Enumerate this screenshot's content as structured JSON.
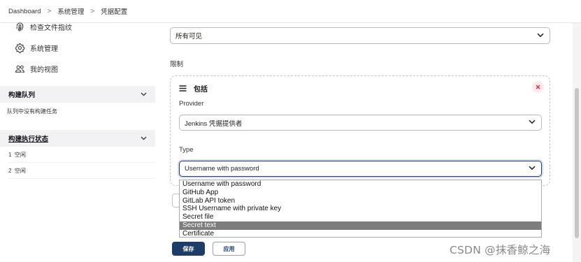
{
  "breadcrumb": {
    "items": [
      "Dashboard",
      "系统管理",
      "凭据配置"
    ],
    "separator": ">"
  },
  "sidebar": {
    "links": [
      {
        "label": "检查文件指纹",
        "icon": "fingerprint-icon"
      },
      {
        "label": "系统管理",
        "icon": "gear-icon"
      },
      {
        "label": "我的视图",
        "icon": "people-icon"
      }
    ],
    "build_queue": {
      "title": "构建队列",
      "empty_text": "队列中没有构建任务"
    },
    "executor_status": {
      "title": "构建执行状态",
      "rows": [
        "1  空闲",
        "2  空闲"
      ]
    }
  },
  "main": {
    "visibility_select": "所有可见",
    "restriction_label": "限制",
    "include_section": {
      "title": "包括",
      "provider_label": "Provider",
      "provider_value": "Jenkins 凭据提供者",
      "type_label": "Type",
      "type_value": "Username with password"
    },
    "type_options": [
      "Username with password",
      "GitHub App",
      "GitLab API token",
      "SSH Username with private key",
      "Secret file",
      "Secret text",
      "Certificate"
    ],
    "highlighted_option": "Secret text",
    "save_label": "保存",
    "apply_label": "应用"
  },
  "watermark": "CSDN @抹香鲸之海",
  "colors": {
    "primary": "#1d3c66",
    "highlight": "#7d7d7d",
    "panel_bg": "#f2f2f4",
    "close_bg": "#fde8ec",
    "close_fg": "#d0304a"
  }
}
